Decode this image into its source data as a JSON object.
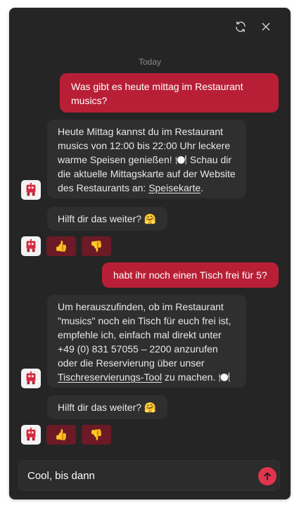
{
  "header": {
    "refresh_icon": "refresh-icon",
    "close_icon": "close-icon"
  },
  "conversation": {
    "day_label": "Today",
    "messages": [
      {
        "role": "user",
        "text": "Was gibt es heute mittag im Restaurant musics?"
      },
      {
        "role": "bot",
        "text_before": "Heute Mittag kannst du im Restaurant musics von 12:00 bis 22:00 Uhr leckere warme Speisen genießen! 🍽️ Schau dir die aktuelle Mittagskarte auf der Website des Restaurants an: ",
        "link": "Speisekarte",
        "text_after": "."
      },
      {
        "role": "bot",
        "text": "Hilft dir das weiter? 🤗"
      },
      {
        "role": "user",
        "text": "habt ihr noch einen Tisch frei für 5?"
      },
      {
        "role": "bot",
        "text_before": "Um herauszufinden, ob im Restaurant \"musics\" noch ein Tisch für euch frei ist, empfehle ich, einfach mal direkt unter +49 (0) 831 57055 – 2200 anzurufen oder die Reservierung über unser ",
        "link": "Tischreservierungs-Tool",
        "text_after": " zu machen. 🍽️"
      },
      {
        "role": "bot",
        "text": "Hilft dir das weiter? 🤗"
      }
    ],
    "reactions": {
      "thumbs_up": "👍",
      "thumbs_down": "👎"
    }
  },
  "composer": {
    "value": "Cool, bis dann",
    "send_icon": "arrow-up-icon"
  },
  "colors": {
    "panel_bg": "#252525",
    "bot_bubble": "#2f2f2f",
    "user_bubble": "#b81f36",
    "reaction_bg": "#6c1a26",
    "send_button": "#e0354f"
  }
}
